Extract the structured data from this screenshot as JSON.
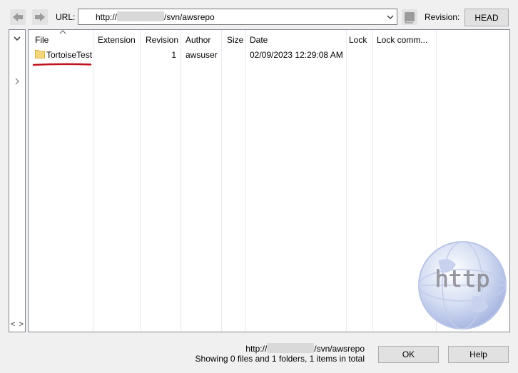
{
  "toolbar": {
    "url_label": "URL:",
    "url_prefix": "http://",
    "url_suffix": "/svn/awsrepo",
    "revision_label": "Revision:",
    "revision_value": "HEAD"
  },
  "columns": [
    "File",
    "Extension",
    "Revision",
    "Author",
    "Size",
    "Date",
    "Lock",
    "Lock comm..."
  ],
  "rows": [
    {
      "file": "TortoiseTest",
      "extension": "",
      "revision": "1",
      "author": "awsuser",
      "size": "",
      "date": "02/09/2023 12:29:08 AM",
      "lock": "",
      "lock_comment": ""
    }
  ],
  "status": {
    "url_prefix": "http://",
    "url_suffix": "/svn/awsrepo",
    "summary": "Showing 0 files and 1 folders, 1 items in total"
  },
  "buttons": {
    "ok": "OK",
    "help": "Help"
  },
  "watermark": {
    "text": "http"
  },
  "colors": {
    "accent_underline": "#c0141e",
    "folder": "#f5d67a",
    "window_bg": "#f0f0f0"
  }
}
